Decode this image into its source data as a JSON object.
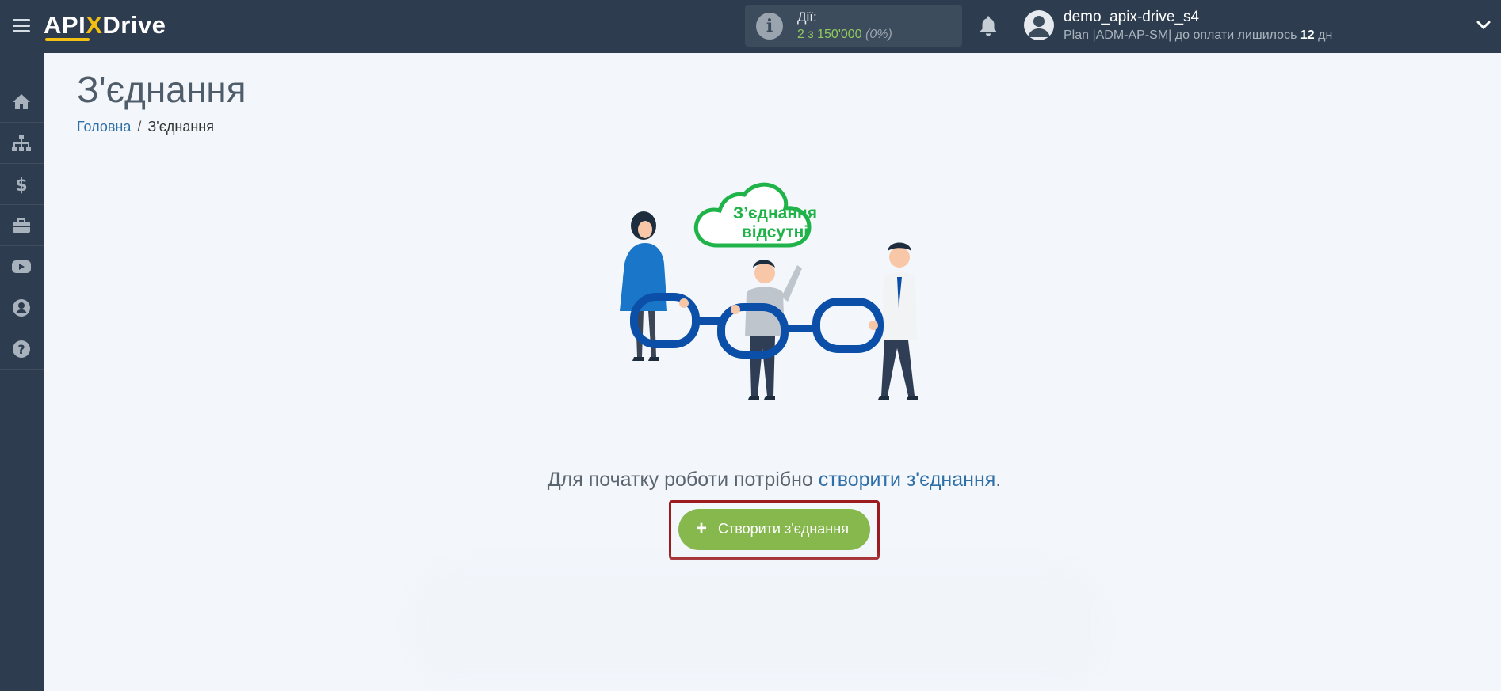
{
  "header": {
    "logo": {
      "part1": "API",
      "x": "X",
      "part2": "Drive"
    },
    "actions": {
      "label": "Дії:",
      "value": "2 з 150'000",
      "percent": "(0%)"
    },
    "user": {
      "name": "demo_apix-drive_s4",
      "plan_prefix": "Plan |ADM-AP-SM| до оплати лишилось ",
      "plan_days": "12",
      "plan_suffix": " дн"
    }
  },
  "sidebar": {
    "items": [
      {
        "icon": "home-icon"
      },
      {
        "icon": "sitemap-icon"
      },
      {
        "icon": "dollar-icon"
      },
      {
        "icon": "briefcase-icon"
      },
      {
        "icon": "youtube-icon"
      },
      {
        "icon": "user-circle-icon"
      },
      {
        "icon": "question-circle-icon"
      }
    ]
  },
  "main": {
    "title": "З'єднання",
    "breadcrumb": {
      "home": "Головна",
      "separator": "/",
      "current": "З'єднання"
    },
    "illustration": {
      "line1": "З’єднання",
      "line2": "відсутні"
    },
    "prompt": {
      "text": "Для початку роботи потрібно ",
      "link": "створити з'єднання",
      "end": "."
    },
    "create_button": {
      "plus": "+",
      "label": "Створити з'єднання"
    }
  },
  "colors": {
    "topbar": "#2d3c4e",
    "accent_green": "#86b84e",
    "link_blue": "#2f6fa8",
    "highlight_frame": "#9b1b20",
    "logo_yellow": "#f2c012"
  }
}
